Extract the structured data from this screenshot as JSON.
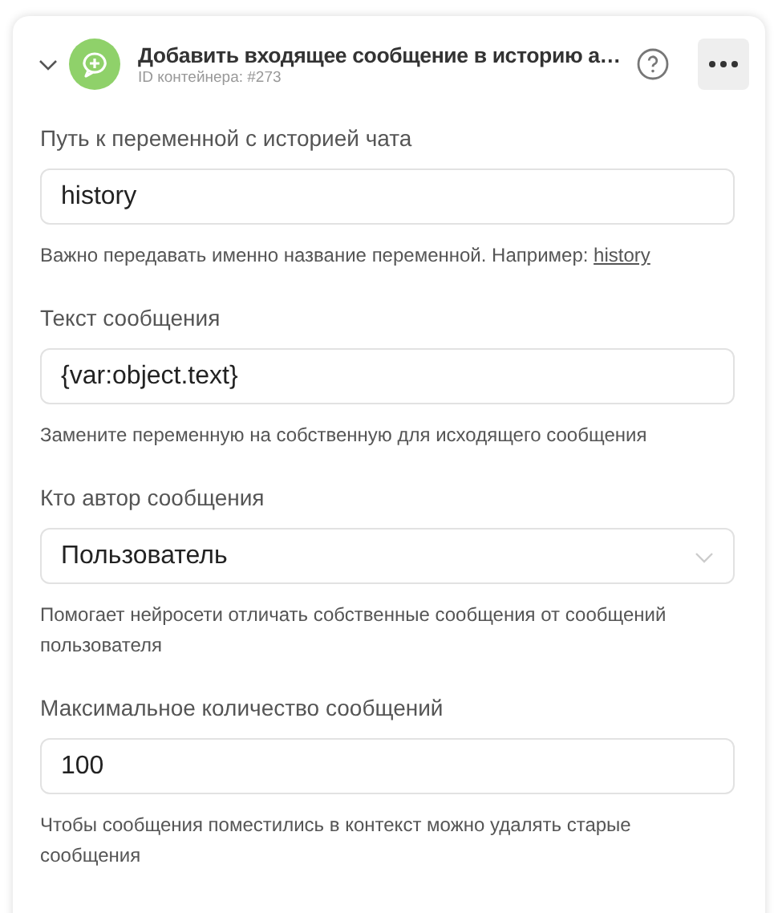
{
  "header": {
    "expanded": true,
    "title": "Добавить входящее сообщение в историю а…",
    "subtitle": "ID контейнера: #273"
  },
  "fields": [
    {
      "kind": "text",
      "label": "Путь к переменной с историей чата",
      "value": "history",
      "hint": "Важно передавать именно название переменной. Например:",
      "hint_link": "history"
    },
    {
      "kind": "text",
      "label": "Текст сообщения",
      "value": "{var:object.text}",
      "hint": "Замените переменную на собственную для исходящего сообщения"
    },
    {
      "kind": "select",
      "label": "Кто автор сообщения",
      "value": "Пользователь",
      "hint": "Помогает нейросети отличать собственные сообщения от сообщений пользователя"
    },
    {
      "kind": "text",
      "label": "Максимальное количество сообщений",
      "value": "100",
      "hint": "Чтобы сообщения поместились в контекст можно удалять старые сообщения"
    }
  ]
}
